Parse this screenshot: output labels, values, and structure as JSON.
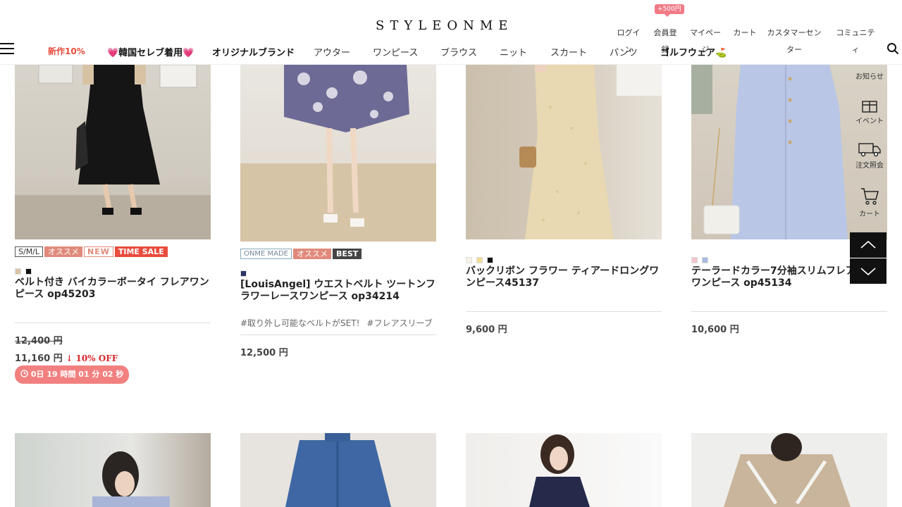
{
  "header": {
    "logo": "STYLEONME",
    "bubble": "+500円",
    "util": [
      {
        "label": "ログイン",
        "key": "login"
      },
      {
        "label": "会員登録",
        "key": "register"
      },
      {
        "label": "マイページ",
        "key": "mypage"
      },
      {
        "label": "カート",
        "key": "cart"
      },
      {
        "label": "カスタマーセンター",
        "key": "customer"
      },
      {
        "label": "コミュニティ",
        "key": "community"
      }
    ],
    "nav": [
      "新作10%",
      "💗韓国セレブ着用💗",
      "オリジナルブランド",
      "アウター",
      "ワンピース",
      "ブラウス",
      "ニット",
      "スカート",
      "パンツ",
      "ゴルフウェア⛳"
    ]
  },
  "products": [
    {
      "tags": [
        "S/M/L",
        "オススメ",
        "NEW",
        "TIME SALE"
      ],
      "swatches": [
        "#d9c4a8",
        "#111111"
      ],
      "title": "ベルト付き バイカラーボータイ フレアワンピース op45203",
      "old_price": "12,400 円",
      "price": "11,160 円",
      "discount": "↓ 10% OFF",
      "timer": "0日 19 時間 01 分 02 秒"
    },
    {
      "tags": [
        "ONME MADE",
        "オススメ",
        "BEST"
      ],
      "swatches": [
        "#2b3566"
      ],
      "title": "[LouisAngel] ウエストベルト ツートンフラワーレースワンピース op34214",
      "hashtags": [
        "#取り外し可能なベルトがSET!",
        "#フレアスリーブ"
      ],
      "price": "12,500 円"
    },
    {
      "swatches": [
        "#f7f1e6",
        "#efdc96",
        "#111111"
      ],
      "title": "バックリボン フラワー ティアードロングワンピース45137",
      "price": "9,600 円"
    },
    {
      "swatches": [
        "#f2c6cf",
        "#a9b8de"
      ],
      "title": "テーラードカラー7分袖スリムフレアワンピース op45134",
      "price": "10,600 円"
    }
  ],
  "sidebar": {
    "notice": "お知らせ",
    "event": "イベント",
    "order": "注文照会",
    "cart": "カート"
  },
  "colors": {
    "accent_red": "#e74c3c",
    "tag_salmon": "#e08a7b",
    "timer_pink": "#f28080"
  }
}
